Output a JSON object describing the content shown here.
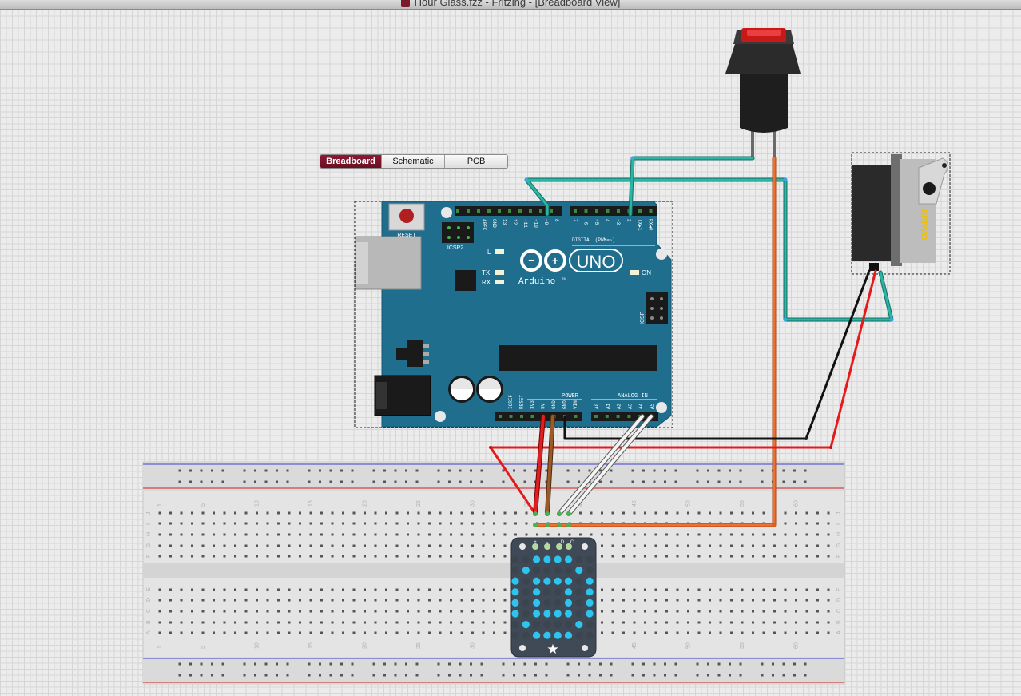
{
  "window": {
    "title": "Hour Glass.fzz - Fritzing - [Breadboard View]"
  },
  "view_tabs": [
    {
      "label": "Breadboard",
      "active": true
    },
    {
      "label": "Schematic",
      "active": false
    },
    {
      "label": "PCB",
      "active": false
    }
  ],
  "arduino": {
    "reset_label": "RESET",
    "icsp2_label": "ICSP2",
    "l_label": "L",
    "tx_label": "TX",
    "rx_label": "RX",
    "on_label": "ON",
    "model_label": "UNO",
    "brand_label": "Arduino",
    "tm": "TM",
    "icsp_label": "ICSP",
    "digital_label": "DIGITAL (PWM=~)",
    "power_label": "POWER",
    "analog_label": "ANALOG IN",
    "digital_pins_left": [
      "AREF",
      "GND",
      "13",
      "12",
      "~11",
      "~10",
      "~9",
      "8"
    ],
    "digital_pins_right": [
      "7",
      "~6",
      "~5",
      "4",
      "~3",
      "2",
      "TX▶1",
      "RX◀0"
    ],
    "power_pins": [
      "IOREF",
      "RESET",
      "3V3",
      "5V",
      "GND",
      "GND",
      "VIN"
    ],
    "analog_pins": [
      "A0",
      "A1",
      "A2",
      "A3",
      "A4",
      "A5"
    ]
  },
  "servo": {
    "label": "SERVO"
  },
  "breadboard": {
    "column_numbers": [
      "1",
      "5",
      "10",
      "15",
      "20",
      "25",
      "30",
      "35",
      "40",
      "45",
      "50",
      "55",
      "60"
    ],
    "rows_top": [
      "J",
      "I",
      "H",
      "G",
      "F"
    ],
    "rows_bottom": [
      "E",
      "D",
      "C",
      "B",
      "A"
    ]
  },
  "matrix_backpack": {
    "pin_labels": [
      "+",
      "-",
      "D",
      "C"
    ]
  },
  "colors": {
    "arduino_blue": "#1f6e8e",
    "wire_teal": "#29b6a4",
    "wire_orange": "#f07030",
    "wire_red": "#e51a1a",
    "wire_black": "#111111",
    "tab_active": "#7a1229",
    "led_blue": "#2ec4f0"
  }
}
